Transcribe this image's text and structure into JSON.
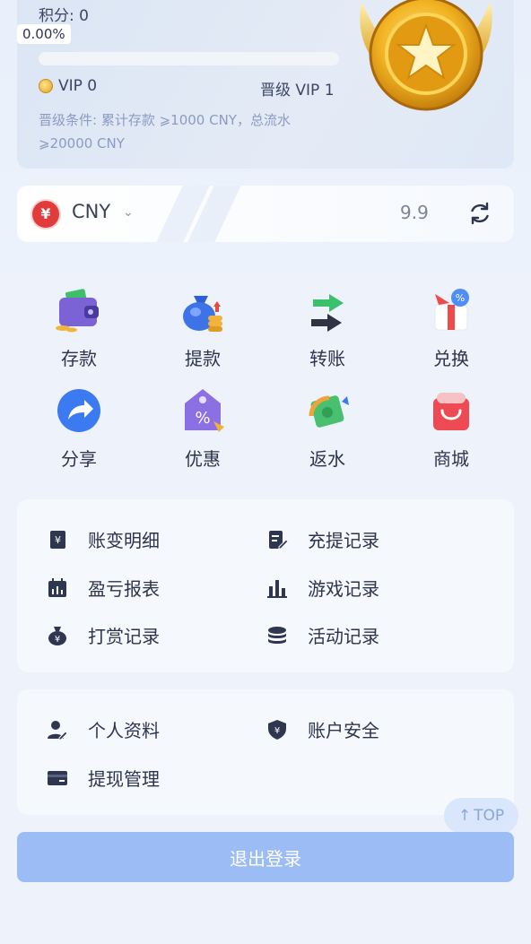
{
  "vip": {
    "points_label": "积分: 0",
    "progress_text": "0.00%",
    "progress_fraction": 0,
    "current_level": "VIP 0",
    "next_level": "晋级 VIP 1",
    "condition": "晋级条件: 累计存款 ⩾1000 CNY，总流水 ⩾20000 CNY"
  },
  "currency": {
    "symbol": "¥",
    "code": "CNY",
    "balance": "9.9"
  },
  "actions": [
    {
      "label": "存款",
      "icon": "wallet-icon"
    },
    {
      "label": "提款",
      "icon": "money-bag-icon"
    },
    {
      "label": "转账",
      "icon": "transfer-icon"
    },
    {
      "label": "兑换",
      "icon": "gift-exchange-icon"
    },
    {
      "label": "分享",
      "icon": "share-icon"
    },
    {
      "label": "优惠",
      "icon": "discount-tag-icon"
    },
    {
      "label": "返水",
      "icon": "rebate-icon"
    },
    {
      "label": "商城",
      "icon": "shop-bag-icon"
    }
  ],
  "records": [
    {
      "label": "账变明细",
      "icon": "ledger-icon"
    },
    {
      "label": "充提记录",
      "icon": "document-edit-icon"
    },
    {
      "label": "盈亏报表",
      "icon": "calendar-chart-icon"
    },
    {
      "label": "游戏记录",
      "icon": "bar-chart-icon"
    },
    {
      "label": "打赏记录",
      "icon": "tip-bag-icon"
    },
    {
      "label": "活动记录",
      "icon": "coin-stack-icon"
    }
  ],
  "account": [
    {
      "label": "个人资料",
      "icon": "user-edit-icon"
    },
    {
      "label": "账户安全",
      "icon": "shield-icon"
    },
    {
      "label": "提现管理",
      "icon": "card-icon"
    }
  ],
  "top_button": "TOP",
  "logout_label": "退出登录"
}
